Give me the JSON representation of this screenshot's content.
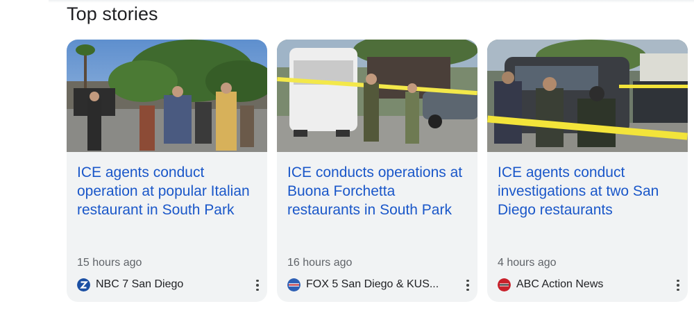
{
  "section": {
    "title": "Top stories"
  },
  "stories": [
    {
      "headline": "ICE agents conduct operation at popular Italian restaurant in South Park",
      "time": "15 hours ago",
      "source": "NBC 7 San Diego",
      "source_icon": "nbc-7-logo-icon",
      "image": "street-crowd-photo"
    },
    {
      "headline": "ICE conducts operations at Buona Forchetta restaurants in South Park",
      "time": "16 hours ago",
      "source": "FOX 5 San Diego & KUS...",
      "source_icon": "fox-5-logo-icon",
      "image": "white-van-officers-photo"
    },
    {
      "headline": "ICE agents conduct investigations at two San Diego restaurants",
      "time": "4 hours ago",
      "source": "ABC Action News",
      "source_icon": "abc-action-news-logo-icon",
      "image": "agents-police-tape-photo"
    }
  ],
  "colors": {
    "headline": "#1a57c9",
    "card_bg": "#f1f3f4",
    "meta_text": "#5f6368"
  }
}
